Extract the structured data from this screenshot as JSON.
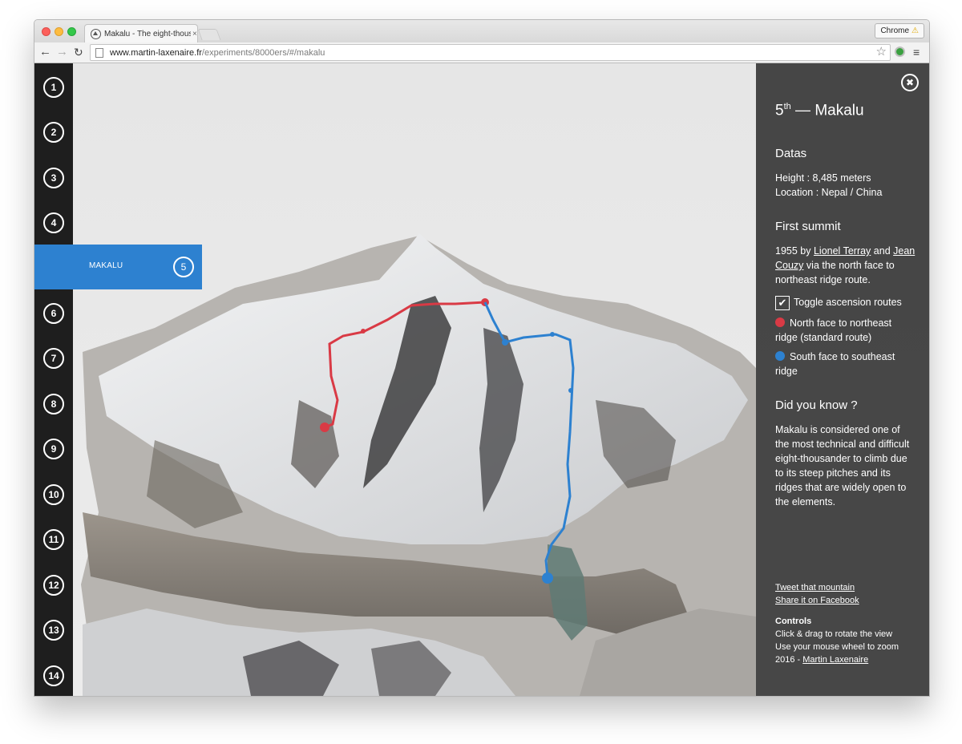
{
  "browser": {
    "tab_title": "Makalu - The eight-thousa",
    "tab_close": "×",
    "profile_label": "Chrome",
    "url_host": "www.martin-laxenaire.fr",
    "url_path": "/experiments/8000ers/#/makalu"
  },
  "rail": {
    "items": [
      "1",
      "2",
      "3",
      "4",
      "6",
      "7",
      "8",
      "9",
      "10",
      "11",
      "12",
      "13",
      "14"
    ],
    "active_number": "5",
    "active_label": "MAKALU"
  },
  "panel": {
    "title_rank": "5",
    "title_suffix": "th",
    "title_name": "— Makalu",
    "datas_heading": "Datas",
    "height": "Height : 8,485 meters",
    "location": "Location : Nepal / China",
    "first_summit_heading": "First summit",
    "summit_year": "1955 by",
    "climber1": "Lionel Terray",
    "and_word": "and",
    "climber2": "Jean Couzy",
    "summit_route": "via the north face to northeast ridge route.",
    "toggle_label": "Toggle ascension routes",
    "route1": "North face to northeast ridge (standard route)",
    "route2": "South face to southeast ridge",
    "route1_color": "#d93a45",
    "route2_color": "#2d81d0",
    "did_you_know_heading": "Did you know ?",
    "did_you_know_text": "Makalu is considered one of the most technical and difficult eight-thousander to climb due to its steep pitches and its ridges that are widely open to the elements.",
    "tweet_link": "Tweet that mountain",
    "facebook_link": "Share it on Facebook",
    "controls_heading": "Controls",
    "controls_line1": "Click & drag to rotate the view",
    "controls_line2": "Use your mouse wheel to zoom",
    "credit_year": "2016 -",
    "credit_name": "Martin Laxenaire"
  }
}
